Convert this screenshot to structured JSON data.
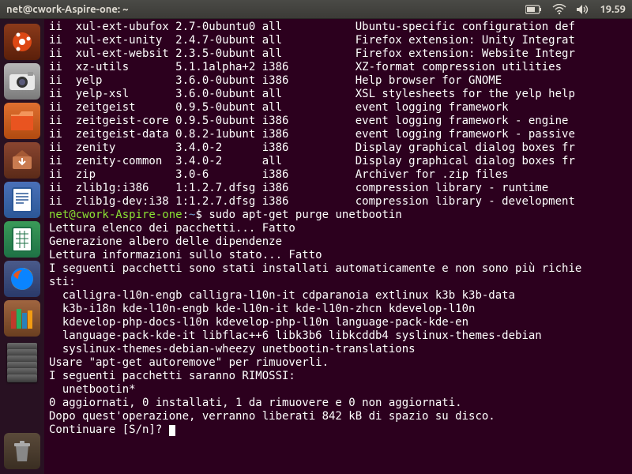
{
  "topbar": {
    "title": "net@cwork-Aspire-one: ~",
    "time": "19.59"
  },
  "launcher": {
    "items": [
      {
        "name": "dash",
        "color": "#dd4814"
      },
      {
        "name": "camera",
        "color": "#7a7a7a"
      },
      {
        "name": "files",
        "color": "#e95420"
      },
      {
        "name": "software",
        "color": "#a0392e"
      },
      {
        "name": "writer",
        "color": "#2b5797"
      },
      {
        "name": "calc",
        "color": "#1e7145"
      },
      {
        "name": "firefox",
        "color": "#e66000"
      },
      {
        "name": "books",
        "color": "#8a4b2a"
      }
    ]
  },
  "terminal": {
    "dpkg_rows": [
      {
        "s": "ii",
        "n": "xul-ext-ubufox",
        "v": "2.7-0ubuntu0",
        "a": "all",
        "d": "Ubuntu-specific configuration def"
      },
      {
        "s": "ii",
        "n": "xul-ext-unity",
        "v": "2.4.7-0ubunt",
        "a": "all",
        "d": "Firefox extension: Unity Integrat"
      },
      {
        "s": "ii",
        "n": "xul-ext-websit",
        "v": "2.3.5-0ubunt",
        "a": "all",
        "d": "Firefox extension: Website Integr"
      },
      {
        "s": "ii",
        "n": "xz-utils",
        "v": "5.1.1alpha+2",
        "a": "i386",
        "d": "XZ-format compression utilities"
      },
      {
        "s": "ii",
        "n": "yelp",
        "v": "3.6.0-0ubunt",
        "a": "i386",
        "d": "Help browser for GNOME"
      },
      {
        "s": "ii",
        "n": "yelp-xsl",
        "v": "3.6.0-0ubunt",
        "a": "all",
        "d": "XSL stylesheets for the yelp help"
      },
      {
        "s": "ii",
        "n": "zeitgeist",
        "v": "0.9.5-0ubunt",
        "a": "all",
        "d": "event logging framework"
      },
      {
        "s": "ii",
        "n": "zeitgeist-core",
        "v": "0.9.5-0ubunt",
        "a": "i386",
        "d": "event logging framework - engine"
      },
      {
        "s": "ii",
        "n": "zeitgeist-data",
        "v": "0.8.2-1ubunt",
        "a": "i386",
        "d": "event logging framework - passive"
      },
      {
        "s": "ii",
        "n": "zenity",
        "v": "3.4.0-2",
        "a": "i386",
        "d": "Display graphical dialog boxes fr"
      },
      {
        "s": "ii",
        "n": "zenity-common",
        "v": "3.4.0-2",
        "a": "all",
        "d": "Display graphical dialog boxes fr"
      },
      {
        "s": "ii",
        "n": "zip",
        "v": "3.0-6",
        "a": "i386",
        "d": "Archiver for .zip files"
      },
      {
        "s": "ii",
        "n": "zlib1g:i386",
        "v": "1:1.2.7.dfsg",
        "a": "i386",
        "d": "compression library - runtime"
      },
      {
        "s": "ii",
        "n": "zlib1g-dev:i38",
        "v": "1:1.2.7.dfsg",
        "a": "i386",
        "d": "compression library - development"
      }
    ],
    "prompt": {
      "userhost": "net@cwork-Aspire-one",
      "sep": ":",
      "path": "~",
      "dollar": "$"
    },
    "command": "sudo apt-get purge unetbootin",
    "out_lines": [
      "Lettura elenco dei pacchetti... Fatto",
      "Generazione albero delle dipendenze",
      "Lettura informazioni sullo stato... Fatto",
      "I seguenti pacchetti sono stati installati automaticamente e non sono più richie",
      "sti:",
      "  calligra-l10n-engb calligra-l10n-it cdparanoia extlinux k3b k3b-data",
      "  k3b-i18n kde-l10n-engb kde-l10n-it kde-l10n-zhcn kdevelop-l10n",
      "  kdevelop-php-docs-l10n kdevelop-php-l10n language-pack-kde-en",
      "  language-pack-kde-it libflac++6 libk3b6 libkcddb4 syslinux-themes-debian",
      "  syslinux-themes-debian-wheezy unetbootin-translations",
      "Usare \"apt-get autoremove\" per rimuoverli.",
      "I seguenti pacchetti saranno RIMOSSI:",
      "  unetbootin*",
      "0 aggiornati, 0 installati, 1 da rimuovere e 0 non aggiornati.",
      "Dopo quest'operazione, verranno liberati 842 kB di spazio su disco.",
      "Continuare [S/n]? "
    ]
  }
}
